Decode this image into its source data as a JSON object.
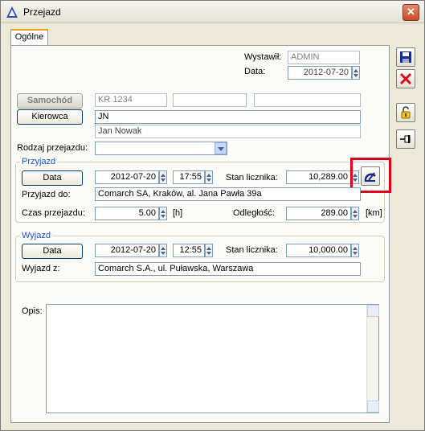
{
  "window": {
    "title": "Przejazd"
  },
  "tabs": [
    {
      "label": "Ogólne"
    }
  ],
  "header": {
    "issued_by_label": "Wystawił:",
    "issued_by_value": "ADMIN",
    "date_label": "Data:",
    "date_value": "2012-07-20"
  },
  "vehicle": {
    "car_button": "Samochód",
    "car_value": "KR 1234",
    "car_extra1": "",
    "car_extra2": "",
    "driver_button": "Kierowca",
    "driver_code": "JN",
    "driver_name": "Jan Nowak",
    "trip_type_label": "Rodzaj przejazdu:",
    "trip_type_value": ""
  },
  "arrival": {
    "group_title": "Przyjazd",
    "date_button": "Data",
    "date_value": "2012-07-20",
    "time_value": "17:55",
    "odometer_label": "Stan licznika:",
    "odometer_value": "10,289.00",
    "to_label": "Przyjazd do:",
    "to_value": "Comarch SA, Kraków, al. Jana Pawła 39a",
    "duration_label": "Czas przejazdu:",
    "duration_value": "5.00",
    "duration_unit": "[h]",
    "distance_label": "Odległość:",
    "distance_value": "289.00",
    "distance_unit": "[km]"
  },
  "departure": {
    "group_title": "Wyjazd",
    "date_button": "Data",
    "date_value": "2012-07-20",
    "time_value": "12:55",
    "odometer_label": "Stan licznika:",
    "odometer_value": "10,000.00",
    "from_label": "Wyjazd z:",
    "from_value": "Comarch S.A., ul. Puławska, Warszawa"
  },
  "description": {
    "label": "Opis:",
    "value": ""
  },
  "colors": {
    "highlight": "#e0001b",
    "group_title": "#1c4fd4"
  }
}
